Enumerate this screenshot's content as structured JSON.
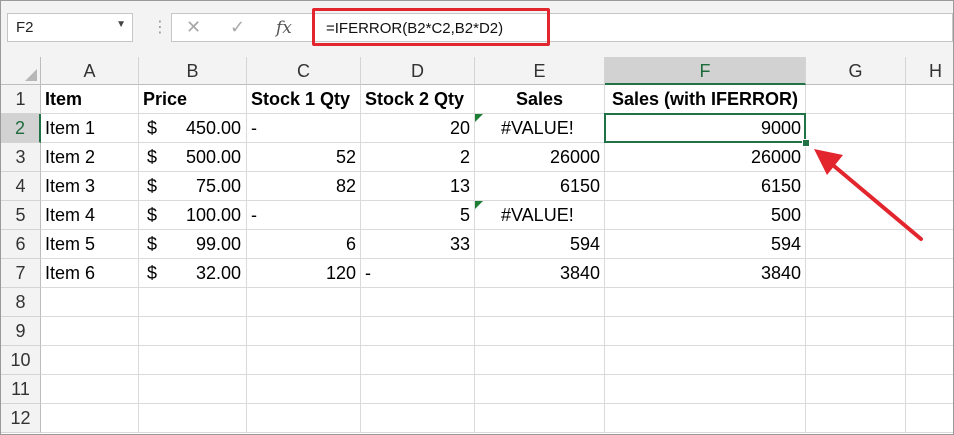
{
  "name_box": {
    "value": "F2",
    "dropdown_icon": "chevron-down-icon"
  },
  "formula_buttons": {
    "cancel_icon": "close-icon",
    "enter_icon": "check-icon",
    "fx_label": "fx"
  },
  "formula_bar": {
    "value": "=IFERROR(B2*C2,B2*D2)"
  },
  "columns": [
    "A",
    "B",
    "C",
    "D",
    "E",
    "F",
    "G",
    "H"
  ],
  "selected_column": "F",
  "rows": [
    "1",
    "2",
    "3",
    "4",
    "5",
    "6",
    "7",
    "8",
    "9",
    "10",
    "11",
    "12"
  ],
  "selected_row": "2",
  "header_row": [
    "Item",
    "Price",
    "Stock 1 Qty",
    "Stock 2 Qty",
    "Sales",
    "Sales (with IFERROR)"
  ],
  "data_rows": [
    {
      "item": "Item 1",
      "currency": "$",
      "price": "450.00",
      "stock1": "-",
      "stock2": "20",
      "sales": "#VALUE!",
      "sales_iferror": "9000"
    },
    {
      "item": "Item 2",
      "currency": "$",
      "price": "500.00",
      "stock1": "52",
      "stock2": "2",
      "sales": "26000",
      "sales_iferror": "26000"
    },
    {
      "item": "Item 3",
      "currency": "$",
      "price": "75.00",
      "stock1": "82",
      "stock2": "13",
      "sales": "6150",
      "sales_iferror": "6150"
    },
    {
      "item": "Item 4",
      "currency": "$",
      "price": "100.00",
      "stock1": "-",
      "stock2": "5",
      "sales": "#VALUE!",
      "sales_iferror": "500"
    },
    {
      "item": "Item 5",
      "currency": "$",
      "price": "99.00",
      "stock1": "6",
      "stock2": "33",
      "sales": "594",
      "sales_iferror": "594"
    },
    {
      "item": "Item 6",
      "currency": "$",
      "price": "32.00",
      "stock1": "120",
      "stock2": "-",
      "sales": "3840",
      "sales_iferror": "3840"
    }
  ],
  "colors": {
    "accent": "#217346",
    "annotation": "#e3262e",
    "header_bg": "#f3f3f3"
  }
}
